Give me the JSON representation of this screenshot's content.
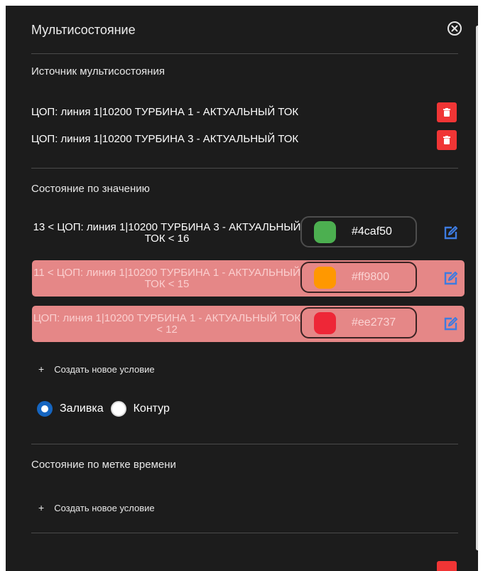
{
  "dialog": {
    "title": "Мультисостояние",
    "close_icon": "close-circle-icon"
  },
  "sources": {
    "heading": "Источник мультисостояния",
    "items": [
      {
        "label": "ЦОП: линия 1|10200 ТУРБИНА 1 - АКТУАЛЬНЫЙ ТОК",
        "action_icon": "trash-icon"
      },
      {
        "label": "ЦОП: линия 1|10200 ТУРБИНА 3 - АКТУАЛЬНЫЙ ТОК",
        "action_icon": "trash-icon"
      }
    ]
  },
  "value_state": {
    "heading": "Состояние по значению",
    "conditions": [
      {
        "text": "13 < ЦОП: линия 1|10200 ТУРБИНА 3 - АКТУАЛЬНЫЙ ТОК < 16",
        "color": "#4caf50",
        "highlighted": false,
        "edit_icon": "edit-icon"
      },
      {
        "text": "11 < ЦОП: линия 1|10200 ТУРБИНА 1 - АКТУАЛЬНЫЙ ТОК < 15",
        "color": "#ff9800",
        "highlighted": true,
        "edit_icon": "edit-icon"
      },
      {
        "text": "ЦОП: линия 1|10200 ТУРБИНА 1 - АКТУАЛЬНЫЙ ТОК < 12",
        "color": "#ee2737",
        "highlighted": true,
        "edit_icon": "edit-icon"
      }
    ],
    "add_label": "Создать новое условие",
    "fill_mode": {
      "options": [
        "Заливка",
        "Контур"
      ],
      "selected": "Заливка"
    }
  },
  "time_state": {
    "heading": "Состояние по метке времени",
    "add_label": "Создать новое условие"
  },
  "colors": {
    "panel_bg": "#1c1c1c",
    "danger": "#f03535",
    "highlight_row": "#e58787",
    "edit_accent": "#3d7be0",
    "radio_accent": "#1565c0"
  }
}
